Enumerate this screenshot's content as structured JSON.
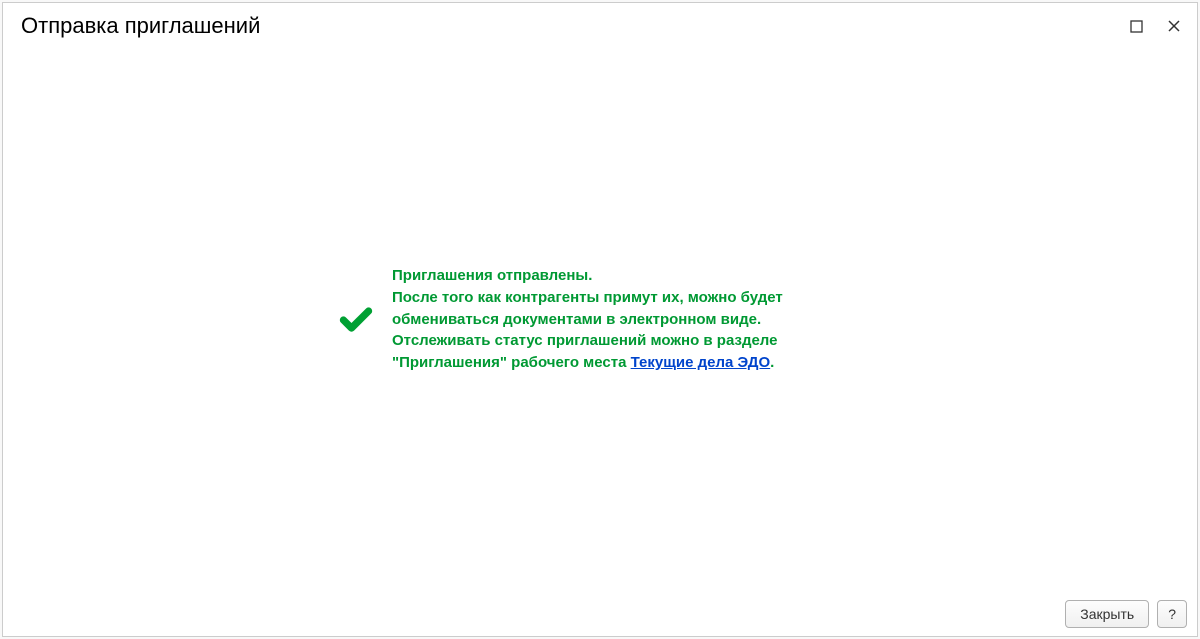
{
  "header": {
    "title": "Отправка приглашений"
  },
  "message": {
    "line1": "Приглашения отправлены.",
    "line2": "После того как контрагенты примут их, можно будет обмениваться документами в электронном виде.",
    "line3": "Отслеживать статус приглашений можно в разделе \"Приглашения\" рабочего места ",
    "link": "Текущие дела ЭДО",
    "period": "."
  },
  "footer": {
    "close_label": "Закрыть",
    "help_label": "?"
  }
}
